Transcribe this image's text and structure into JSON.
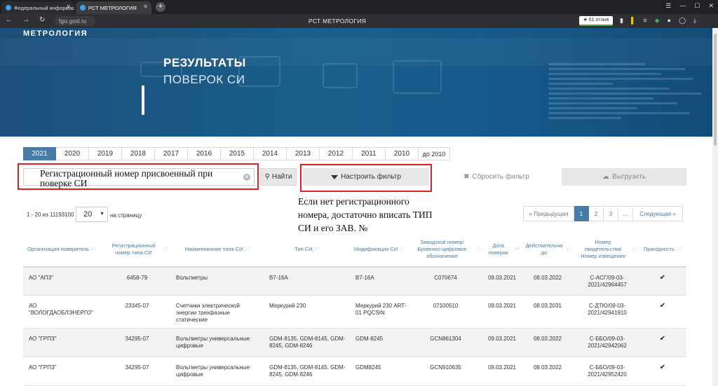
{
  "browser": {
    "tabs": [
      {
        "label": "Федеральный информаци"
      },
      {
        "label": "РСТ МЕТРОЛОГИЯ"
      }
    ],
    "url": "fgis.gost.ru",
    "page_title": "РСТ МЕТРОЛОГИЯ",
    "reviews_badge": "★ 61 отзыв"
  },
  "banner": {
    "brand": "МЕТРОЛОГИЯ",
    "title_line1": "РЕЗУЛЬТАТЫ",
    "title_line2": "ПОВЕРОК СИ"
  },
  "years": [
    "2021",
    "2020",
    "2019",
    "2018",
    "2017",
    "2016",
    "2015",
    "2014",
    "2013",
    "2012",
    "2011",
    "2010",
    "до 2010"
  ],
  "active_year": "2021",
  "search": {
    "placeholder": "Регистрационный номер присвоенный при поверке СИ",
    "find_label": "Найти",
    "filter_label": "Настроить фильтр",
    "reset_label": "Сбросить фильтр",
    "export_label": "Выгрузить"
  },
  "annotation": "Если нет регистрационного номера, достаточно вписать ТИП СИ и его ЗАВ. №",
  "pagination": {
    "range_text": "1 - 20 из 11193100",
    "per_page": "20",
    "per_page_label": "на страницу",
    "prev_label": "« Предыдущая",
    "pages": [
      "1",
      "2",
      "3",
      "..."
    ],
    "active_page": "1",
    "next_label": "Следующая »"
  },
  "table": {
    "columns": [
      "Организация-поверитель",
      "Регистрационный номер типа СИ",
      "Наименование типа СИ",
      "Тип СИ",
      "Модификация СИ",
      "Заводской номер/ Буквенно-цифровое обозначение",
      "Дата поверки",
      "Действительна до",
      "Номер свидетельства/ Номер извещения",
      "Пригодность"
    ],
    "rows": [
      {
        "org": "АО \"АПЗ\"",
        "reg": "6458-79",
        "name": "Вольтметры",
        "type": "В7-16А",
        "mod": "В7-16А",
        "serial": "С070674",
        "date": "09.03.2021",
        "valid": "08.03.2022",
        "cert": "С-АСГ/09-03-2021/42964457",
        "ok": "✔"
      },
      {
        "org": "АО \"ВОЛОГДАОБЛЭНЕРГО\"",
        "reg": "23345-07",
        "name": "Счетчики электрической энергии трехфазные статические",
        "type": "Меркурий 230",
        "mod": "Меркурий 230 ART-01 PQCSIN",
        "serial": "07100510",
        "date": "09.03.2021",
        "valid": "08.03.2031",
        "cert": "С-ДТЮ/09-03-2021/42941910",
        "ok": "✔"
      },
      {
        "org": "АО \"ГРПЗ\"",
        "reg": "34295-07",
        "name": "Вольтметры универсальные цифровые",
        "type": "GDM-8135, GDM-8145, GDM-8245, GDM-8246",
        "mod": "GDM-8245",
        "serial": "GCN861304",
        "date": "09.03.2021",
        "valid": "08.03.2022",
        "cert": "С-ББО/09-03-2021/42942062",
        "ok": "✔"
      },
      {
        "org": "АО \"ГРПЗ\"",
        "reg": "34295-07",
        "name": "Вольтметры универсальные цифровые",
        "type": "GDM-8135, GDM-8145, GDM-8245, GDM-8246",
        "mod": "GDM8245",
        "serial": "GCN910635",
        "date": "09.03.2021",
        "valid": "08.03.2022",
        "cert": "С-ББО/09-03-2021/42952420",
        "ok": "✔"
      }
    ]
  },
  "colors": {
    "accent": "#4a7ba6",
    "banner": "#1a5f8c",
    "highlight": "#e02020"
  }
}
